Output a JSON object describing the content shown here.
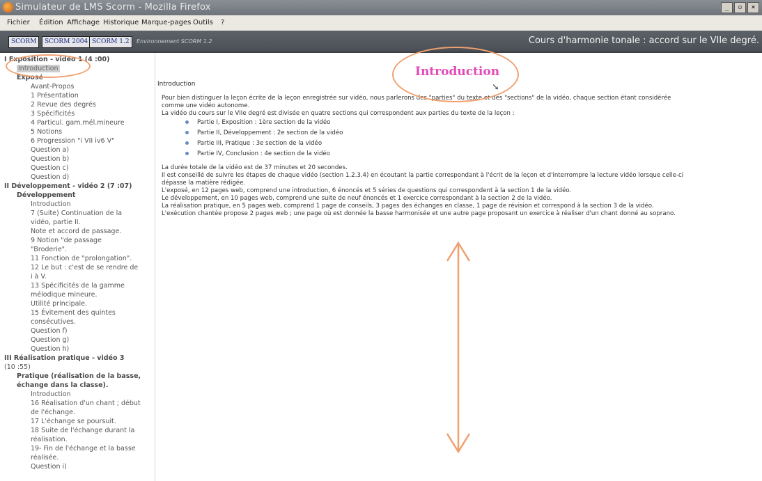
{
  "window": {
    "title": "Simulateur de LMS Scorm - Mozilla Firefox",
    "min": "_",
    "restore": "▫",
    "close": "×"
  },
  "menu": [
    "Fichier",
    "Édition",
    "Affichage",
    "Historique",
    "Marque-pages",
    "Outils",
    "?"
  ],
  "scorm_buttons": [
    "SCORM",
    "SCORM 2004",
    "SCORM 1.2"
  ],
  "env_separator": "|",
  "env_label": "Environnement SCORM 1.2",
  "course_title": "Cours d'harmonie tonale : accord sur le VIIe degré.",
  "sidebar": [
    {
      "text": "I Exposition - vidéo 1 (4 :00)",
      "bold": true,
      "indent": 0
    },
    {
      "text": "Introduction",
      "bold": false,
      "indent": 1,
      "selected": true
    },
    {
      "text": "Exposé",
      "bold": true,
      "indent": 1
    },
    {
      "text": "Avant-Propos",
      "indent": 2
    },
    {
      "text": "1 Présentation",
      "indent": 2
    },
    {
      "text": "2 Revue des degrés",
      "indent": 2
    },
    {
      "text": "3 Spécificités",
      "indent": 2
    },
    {
      "text": "4 Particul. gam.mél.mineure",
      "indent": 2
    },
    {
      "text": "5 Notions",
      "indent": 2
    },
    {
      "text": "6 Progression \"i VII iv6 V\"",
      "indent": 2
    },
    {
      "text": "Question a)",
      "indent": 2
    },
    {
      "text": "Question b)",
      "indent": 2
    },
    {
      "text": "Question c)",
      "indent": 2
    },
    {
      "text": "Question d)",
      "indent": 2
    },
    {
      "text": "II Développement - vidéo 2 (7 :07)",
      "bold": true,
      "indent": 0
    },
    {
      "text": "Développement",
      "bold": true,
      "indent": 1
    },
    {
      "text": "Introduction",
      "indent": 2
    },
    {
      "text": "7 (Suite) Continuation de la",
      "indent": 2
    },
    {
      "text": "vidéo, partie II.",
      "indent": 2
    },
    {
      "text": "Note et accord de passage.",
      "indent": 2
    },
    {
      "text": "9 Notion \"de passage",
      "indent": 2
    },
    {
      "text": "\"Broderie\".",
      "indent": 2
    },
    {
      "text": "11 Fonction de \"prolongation\".",
      "indent": 2
    },
    {
      "text": "12 Le but : c'est de se rendre de",
      "indent": 2
    },
    {
      "text": "i à V.",
      "indent": 2
    },
    {
      "text": "13 Spécificités de la gamme",
      "indent": 2
    },
    {
      "text": "mélodique mineure.",
      "indent": 2
    },
    {
      "text": "Utilité principale.",
      "indent": 2
    },
    {
      "text": "15 Évitement des quintes",
      "indent": 2
    },
    {
      "text": "consécutives.",
      "indent": 2
    },
    {
      "text": "Question f)",
      "indent": 2
    },
    {
      "text": "Question g)",
      "indent": 2
    },
    {
      "text": "Question h)",
      "indent": 2
    },
    {
      "text": "III Réalisation pratique - vidéo 3",
      "bold": true,
      "indent": 0
    },
    {
      "text": "(10 :55)",
      "bold": false,
      "indent": 0
    },
    {
      "text": "Pratique (réalisation de la basse,",
      "bold": true,
      "indent": 1
    },
    {
      "text": "échange dans la classe).",
      "bold": true,
      "indent": 1
    },
    {
      "text": "Introduction",
      "indent": 2
    },
    {
      "text": "16 Réalisation d'un chant ; début",
      "indent": 2
    },
    {
      "text": "de l'échange.",
      "indent": 2
    },
    {
      "text": "17 L'échange se poursuit.",
      "indent": 2
    },
    {
      "text": "18 Suite de l'échange durant la",
      "indent": 2
    },
    {
      "text": "réalisation.",
      "indent": 2
    },
    {
      "text": "19- Fin de l'échange et la basse",
      "indent": 2
    },
    {
      "text": "réalisée.",
      "indent": 2
    },
    {
      "text": "Question i)",
      "indent": 2
    }
  ],
  "content": {
    "heading": "Introduction",
    "breadcrumb": "Introduction",
    "intro_lines": [
      "Pour bien distinguer la leçon écrite de la leçon enregistrée sur vidéo, nous parlerons des \"parties\" du texte et des \"sections\" de la vidéo, chaque section étant considérée",
      "comme une vidéo autonome.",
      "La vidéo du cours sur le VIIe degré est divisée en quatre sections qui correspondent aux parties du texte de la leçon :"
    ],
    "bullets": [
      "Partie I, Exposition : 1ère section de la vidéo",
      "Partie II, Développement : 2e section de la vidéo",
      "Partie III, Pratique : 3e section de la vidéo",
      "Partie IV, Conclusion : 4e section de la vidéo"
    ],
    "detail_lines": [
      "La durée totale de la vidéo est de 37 minutes et 20 secondes.",
      "Il est conseillé de suivre les étapes de chaque vidéo (section 1.2.3.4) en écoutant la partie correspondant à l'écrit de la leçon et d'interrompre la lecture vidéo lorsque celle-ci",
      "dépasse la matière rédigée.",
      "L'exposé, en 12 pages web, comprend une introduction, 6 énoncés et 5 séries de questions qui correspondent à la section 1 de la vidéo.",
      "Le développement, en 10 pages web, comprend une suite de neuf énoncés et 1 exercice correspondant à la section 2 de la vidéo.",
      "La réalisation pratique, en 5 pages web, comprend 1 page de conseils, 3 pages des échanges en classe, 1 page de révision et correspond à la section 3 de la vidéo.",
      "L'exécution chantée propose 2 pages web ; une page où est donnée la basse harmonisée et une autre page proposant un exercice à réaliser d'un chant donné au soprano."
    ]
  },
  "colors": {
    "heading": "#e24ab4",
    "annotation": "#f0a070",
    "bullet": "#6a8bbf"
  }
}
